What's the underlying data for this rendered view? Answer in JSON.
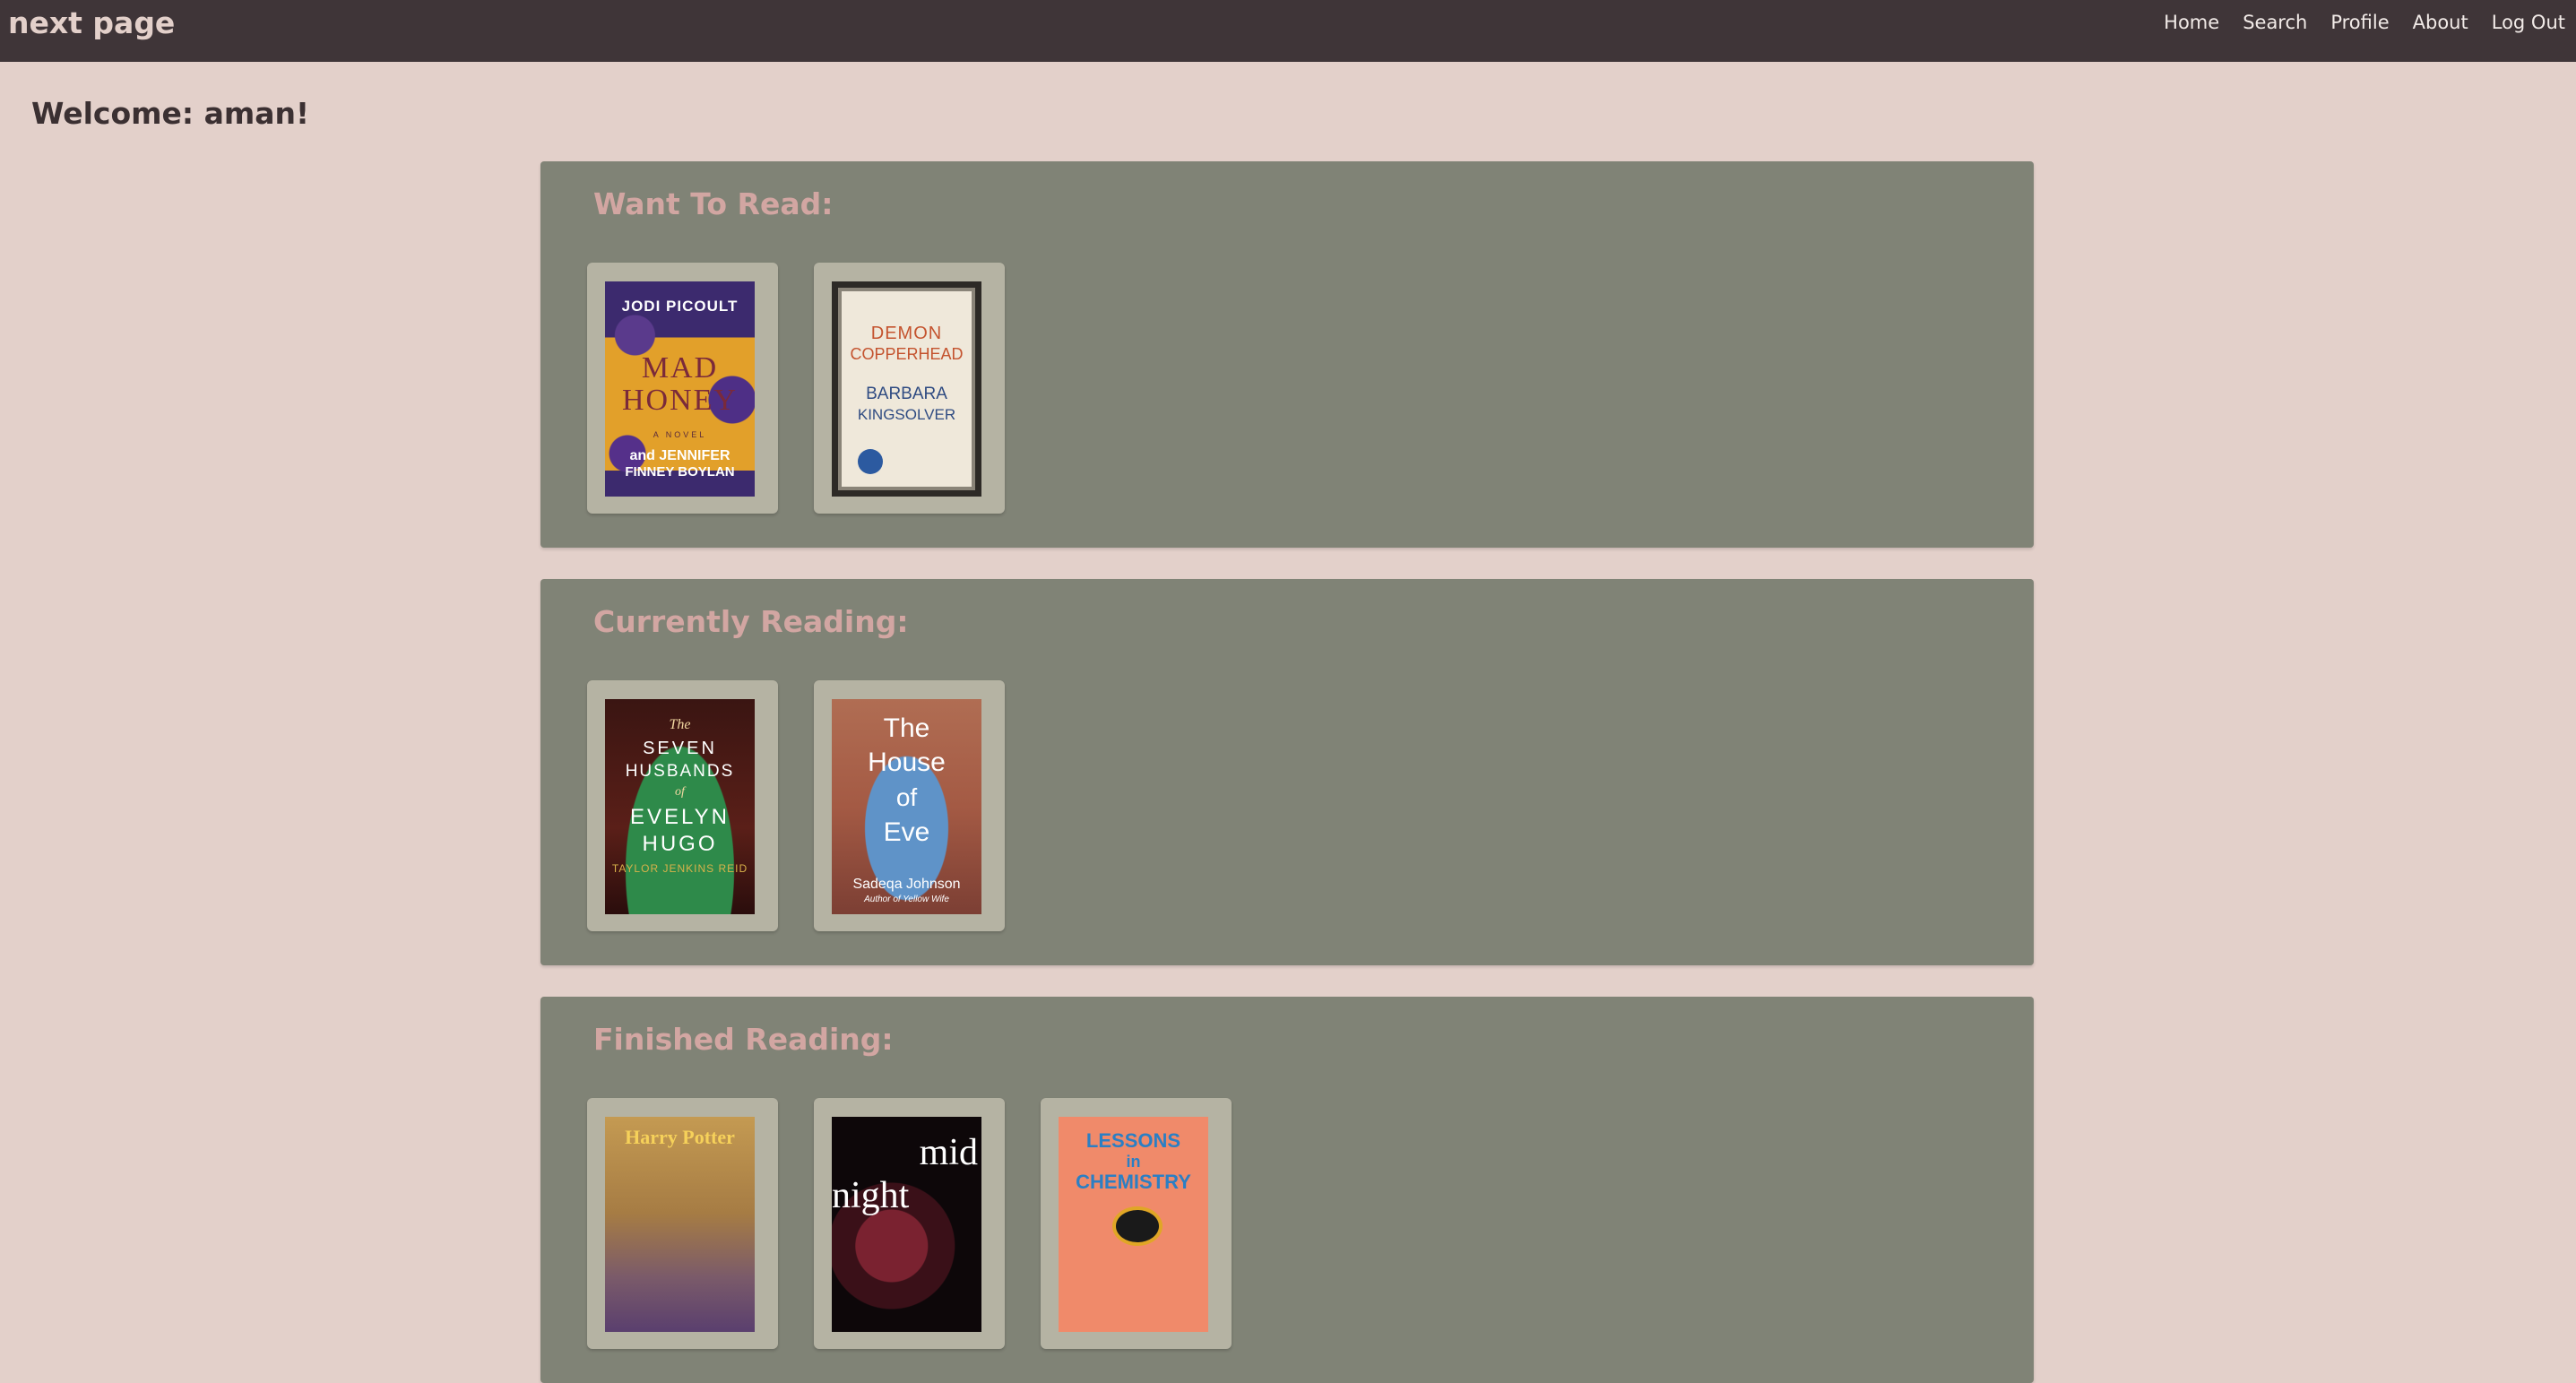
{
  "header": {
    "brand": "next page",
    "nav": [
      "Home",
      "Search",
      "Profile",
      "About",
      "Log Out"
    ]
  },
  "welcome": "Welcome: aman!",
  "shelves": [
    {
      "title": "Want To Read:",
      "books": [
        {
          "author": "JODI PICOULT",
          "title_line1": "MAD",
          "title_line2": "HONEY",
          "subtitle": "A NOVEL",
          "coauthor_line1": "and JENNIFER",
          "coauthor_line2": "FINNEY BOYLAN"
        },
        {
          "title_line1": "DEMON",
          "title_line2": "COPPERHEAD",
          "author_line1": "BARBARA",
          "author_line2": "KINGSOLVER"
        }
      ]
    },
    {
      "title": "Currently Reading:",
      "books": [
        {
          "line1": "The",
          "line2": "SEVEN",
          "line3": "HUSBANDS",
          "line4": "of",
          "line5": "EVELYN",
          "line6": "HUGO",
          "author": "TAYLOR JENKINS REID"
        },
        {
          "line1": "The",
          "line2": "House",
          "line3": "of",
          "line4": "Eve",
          "author": "Sadeqa Johnson",
          "note": "Author of Yellow Wife"
        }
      ]
    },
    {
      "title": "Finished Reading:",
      "books": [
        {
          "line1": "Harry Potter"
        },
        {
          "line1": "mid",
          "line2": "night"
        },
        {
          "line1": "LESSONS",
          "line2": "in",
          "line3": "CHEMISTRY"
        }
      ]
    }
  ],
  "colors": {
    "page_bg": "#e3d0ca",
    "header_bg": "#3f3538",
    "shelf_bg": "#808376",
    "shelf_title": "#d2a6a2",
    "card_bg": "#b5b3a3"
  }
}
